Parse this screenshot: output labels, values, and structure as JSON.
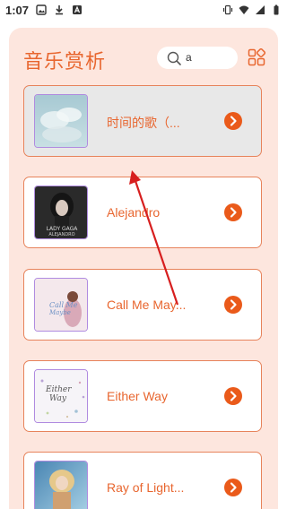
{
  "status_bar": {
    "time": "1:07",
    "left_icons": [
      "image-icon",
      "download-icon",
      "text-a-icon"
    ],
    "right_icons": [
      "vibrate-icon",
      "wifi-icon",
      "signal-icon",
      "battery-icon"
    ]
  },
  "header": {
    "title": "音乐赏析",
    "search_value": "a",
    "accent_color": "#e8662f"
  },
  "songs": [
    {
      "title": "时间的歌（...",
      "selected": true
    },
    {
      "title": "Alejandro",
      "selected": false
    },
    {
      "title": "Call Me May...",
      "selected": false
    },
    {
      "title": "Either Way",
      "selected": false
    },
    {
      "title": "Ray of Light...",
      "selected": false
    }
  ],
  "colors": {
    "panel_bg": "#fde6de",
    "card_border": "#e7835b",
    "play_button": "#ea5a1a",
    "annotation_arrow": "#d71f1f"
  }
}
